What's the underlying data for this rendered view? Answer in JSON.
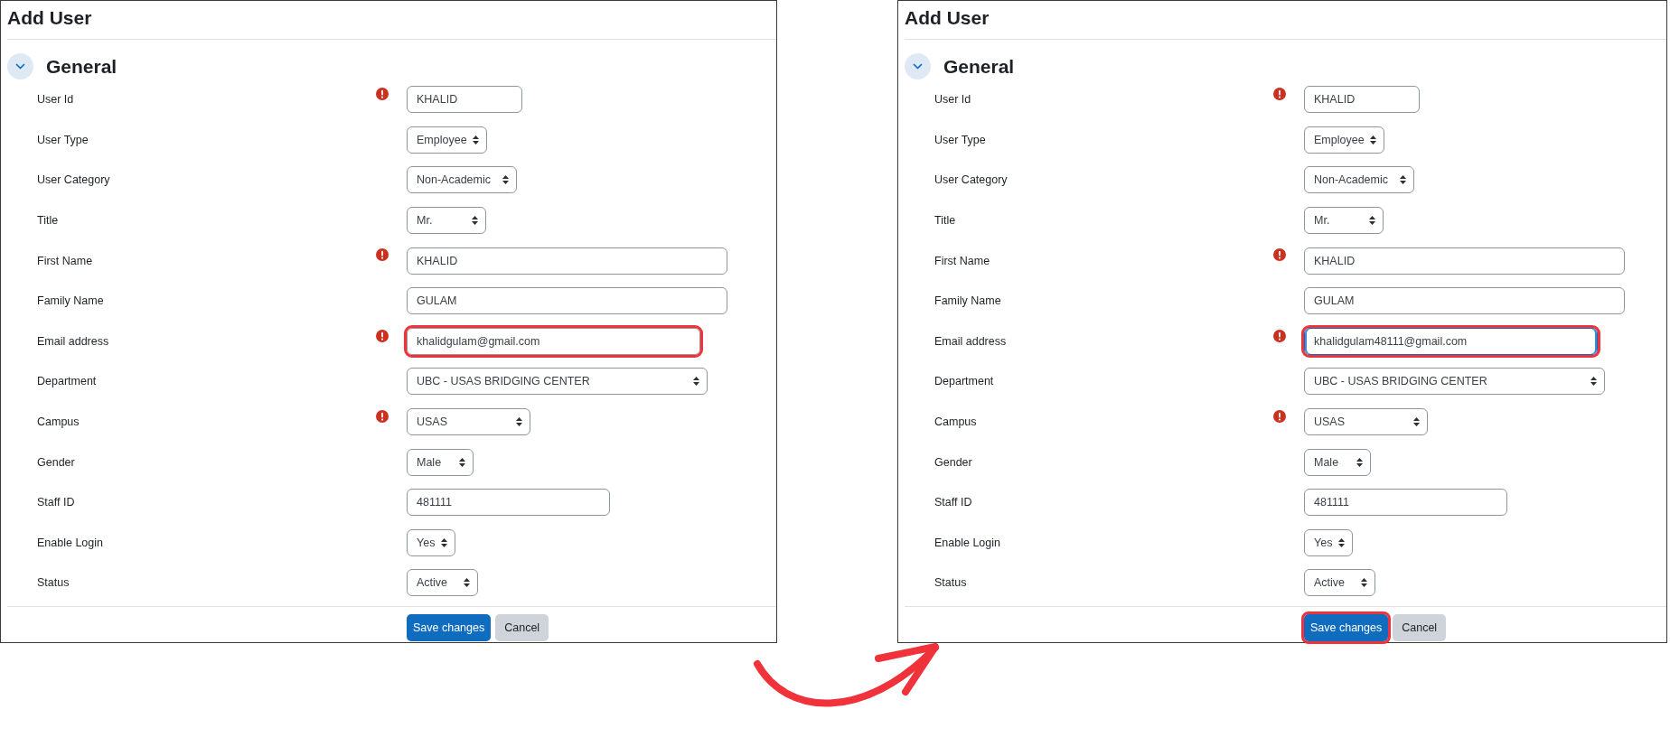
{
  "screens": [
    {
      "title": "Add User",
      "section": {
        "title": "General",
        "expanded": true
      },
      "fields": [
        {
          "label": "User Id",
          "kind": "text",
          "value": "KHALID",
          "required": true,
          "highlighted": false,
          "focused": false
        },
        {
          "label": "User Type",
          "kind": "select",
          "value": "Employee",
          "required": false,
          "highlighted": false,
          "focused": false
        },
        {
          "label": "User Category",
          "kind": "select",
          "value": "Non-Academic",
          "required": false,
          "highlighted": false,
          "focused": false
        },
        {
          "label": "Title",
          "kind": "select",
          "value": "Mr.",
          "required": false,
          "highlighted": false,
          "focused": false
        },
        {
          "label": "First Name",
          "kind": "text",
          "value": "KHALID",
          "required": true,
          "highlighted": false,
          "focused": false
        },
        {
          "label": "Family Name",
          "kind": "text",
          "value": "GULAM",
          "required": false,
          "highlighted": false,
          "focused": false
        },
        {
          "label": "Email address",
          "kind": "text",
          "value": "khalidgulam@gmail.com",
          "required": true,
          "highlighted": true,
          "focused": false
        },
        {
          "label": "Department",
          "kind": "select",
          "value": "UBC - USAS BRIDGING CENTER",
          "required": false,
          "highlighted": false,
          "focused": false
        },
        {
          "label": "Campus",
          "kind": "select",
          "value": "USAS",
          "required": true,
          "highlighted": false,
          "focused": false
        },
        {
          "label": "Gender",
          "kind": "select",
          "value": "Male",
          "required": false,
          "highlighted": false,
          "focused": false
        },
        {
          "label": "Staff ID",
          "kind": "text",
          "value": "481111",
          "required": false,
          "highlighted": false,
          "focused": false
        },
        {
          "label": "Enable Login",
          "kind": "select",
          "value": "Yes",
          "required": false,
          "highlighted": false,
          "focused": false
        },
        {
          "label": "Status",
          "kind": "select",
          "value": "Active",
          "required": false,
          "highlighted": false,
          "focused": false
        }
      ],
      "buttons": [
        {
          "label": "Save changes",
          "kind": "primary",
          "highlighted": false
        },
        {
          "label": "Cancel",
          "kind": "secondary",
          "highlighted": false
        }
      ]
    },
    {
      "title": "Add User",
      "section": {
        "title": "General",
        "expanded": true
      },
      "fields": [
        {
          "label": "User Id",
          "kind": "text",
          "value": "KHALID",
          "required": true,
          "highlighted": false,
          "focused": false
        },
        {
          "label": "User Type",
          "kind": "select",
          "value": "Employee",
          "required": false,
          "highlighted": false,
          "focused": false
        },
        {
          "label": "User Category",
          "kind": "select",
          "value": "Non-Academic",
          "required": false,
          "highlighted": false,
          "focused": false
        },
        {
          "label": "Title",
          "kind": "select",
          "value": "Mr.",
          "required": false,
          "highlighted": false,
          "focused": false
        },
        {
          "label": "First Name",
          "kind": "text",
          "value": "KHALID",
          "required": true,
          "highlighted": false,
          "focused": false
        },
        {
          "label": "Family Name",
          "kind": "text",
          "value": "GULAM",
          "required": false,
          "highlighted": false,
          "focused": false
        },
        {
          "label": "Email address",
          "kind": "text",
          "value": "khalidgulam48111@gmail.com",
          "required": true,
          "highlighted": true,
          "focused": true
        },
        {
          "label": "Department",
          "kind": "select",
          "value": "UBC - USAS BRIDGING CENTER",
          "required": false,
          "highlighted": false,
          "focused": false
        },
        {
          "label": "Campus",
          "kind": "select",
          "value": "USAS",
          "required": true,
          "highlighted": false,
          "focused": false
        },
        {
          "label": "Gender",
          "kind": "select",
          "value": "Male",
          "required": false,
          "highlighted": false,
          "focused": false
        },
        {
          "label": "Staff ID",
          "kind": "text",
          "value": "481111",
          "required": false,
          "highlighted": false,
          "focused": false
        },
        {
          "label": "Enable Login",
          "kind": "select",
          "value": "Yes",
          "required": false,
          "highlighted": false,
          "focused": false
        },
        {
          "label": "Status",
          "kind": "select",
          "value": "Active",
          "required": false,
          "highlighted": false,
          "focused": false
        }
      ],
      "buttons": [
        {
          "label": "Save changes",
          "kind": "primary",
          "highlighted": true
        },
        {
          "label": "Cancel",
          "kind": "secondary",
          "highlighted": false
        }
      ]
    }
  ]
}
